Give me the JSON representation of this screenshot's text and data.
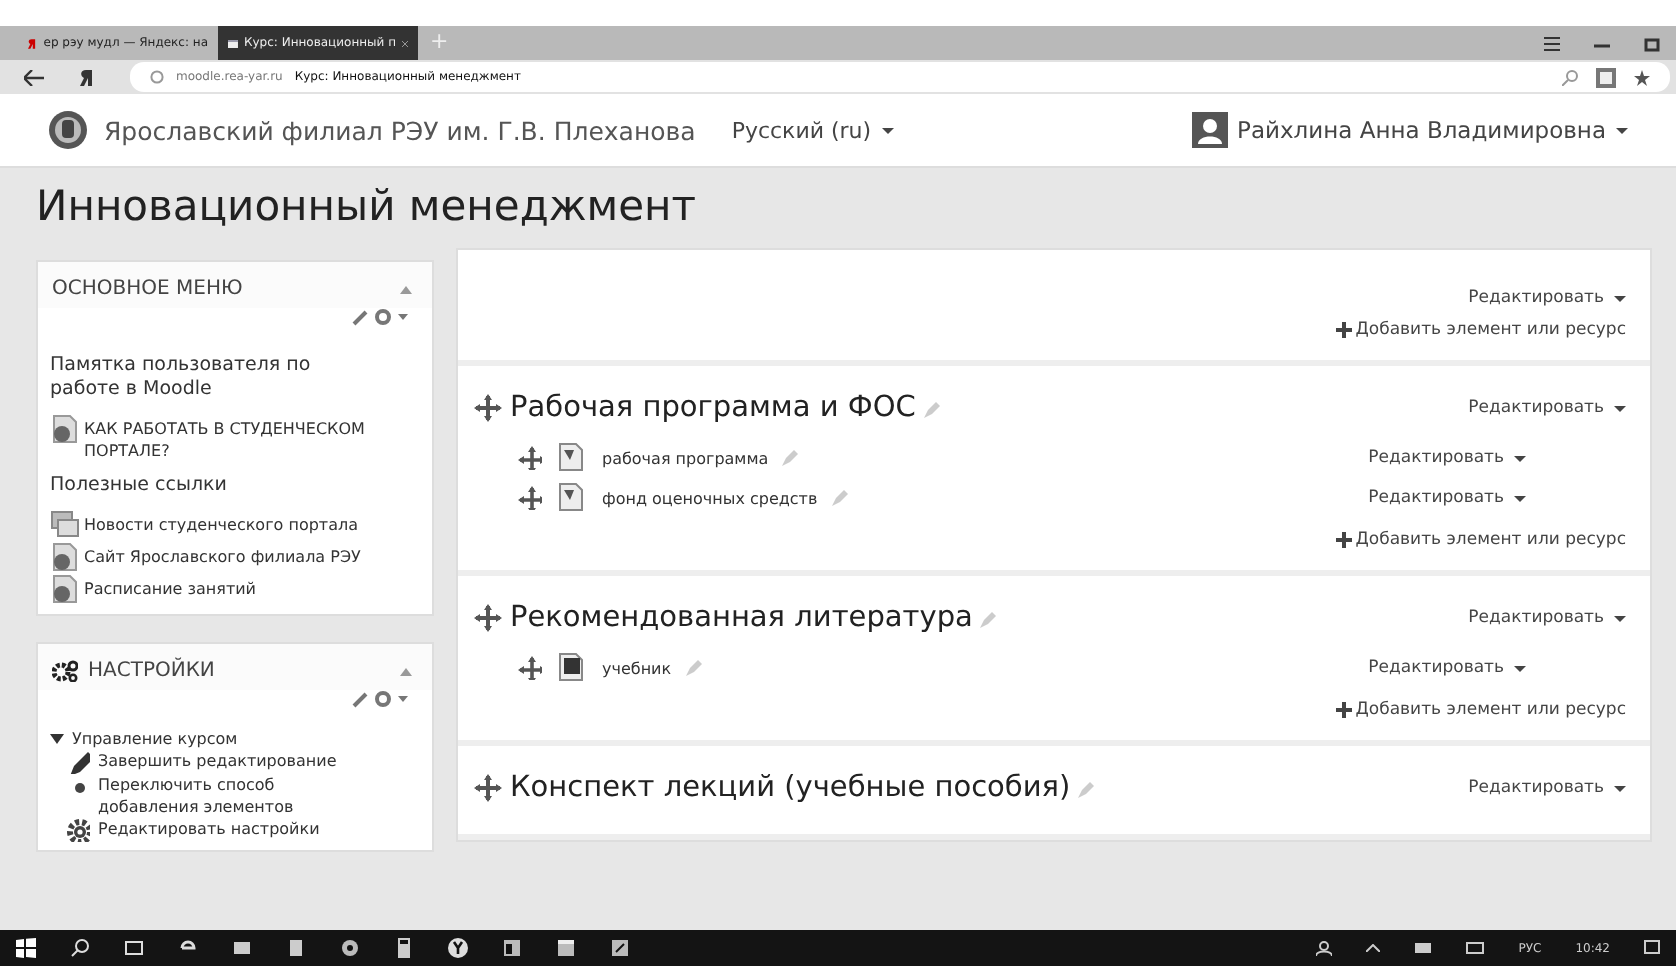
{
  "browser": {
    "tabs": [
      {
        "label": "ер рэу мудл — Яндекс: на",
        "selected": false,
        "kind": "search"
      },
      {
        "label": "Курс: Инновационный п",
        "selected": true,
        "kind": "page"
      }
    ],
    "new_tab": "+",
    "url_host": "moodle.rea-yar.ru",
    "url_title": "Курс: Инновационный менеджмент"
  },
  "header": {
    "site_name": "Ярославский филиал РЭУ им. Г.В. Плеханова",
    "language": "Русский (ru)",
    "user_name": "Райхлина Анна Владимировна"
  },
  "course_title": "Инновационный менеджмент",
  "blocks": [
    {
      "title": "ОСНОВНОЕ МЕНЮ",
      "kind": "menu",
      "items": [
        {
          "kind": "heading",
          "text": "Памятка пользователя по работе в Moodle"
        },
        {
          "kind": "page",
          "text": "КАК РАБОТАТЬ В СТУДЕНЧЕСКОМ ПОРТАЛЕ?"
        },
        {
          "kind": "heading",
          "text": "Полезные ссылки"
        },
        {
          "kind": "forum",
          "text": "Новости студенческого портала"
        },
        {
          "kind": "page",
          "text": "Сайт Ярославского филиала РЭУ"
        },
        {
          "kind": "page",
          "text": "Расписание занятий"
        }
      ]
    },
    {
      "title": "НАСТРОЙКИ",
      "kind": "settings",
      "tree": [
        {
          "text": "Управление курсом",
          "expanded": true,
          "children": [
            {
              "text": "Завершить редактирование",
              "kind": "pencil"
            },
            {
              "text": "Переключить способ добавления элементов",
              "kind": "bullet"
            },
            {
              "text": "Редактировать настройки",
              "kind": "gear"
            }
          ]
        }
      ]
    }
  ],
  "sections": [
    {
      "edit_label": "Редактировать",
      "add_label": "Добавить элемент или ресурс"
    },
    {
      "title": "Рабочая программа и ФОС",
      "edit_label": "Редактировать",
      "items": [
        {
          "name": "рабочая программа",
          "edit_label": "Редактировать",
          "kind": "file"
        },
        {
          "name": "фонд оценочных средств",
          "edit_label": "Редактировать",
          "kind": "file"
        }
      ],
      "add_label": "Добавить элемент или ресурс"
    },
    {
      "title": "Рекомендованная литература",
      "edit_label": "Редактировать",
      "items": [
        {
          "name": "учебник",
          "edit_label": "Редактировать",
          "kind": "book"
        }
      ],
      "add_label": "Добавить элемент или ресурс"
    },
    {
      "title": "Конспект лекций (учебные пособия)",
      "edit_label": "Редактировать"
    }
  ],
  "taskbar": {
    "language": "РУС",
    "time": "10:42"
  }
}
